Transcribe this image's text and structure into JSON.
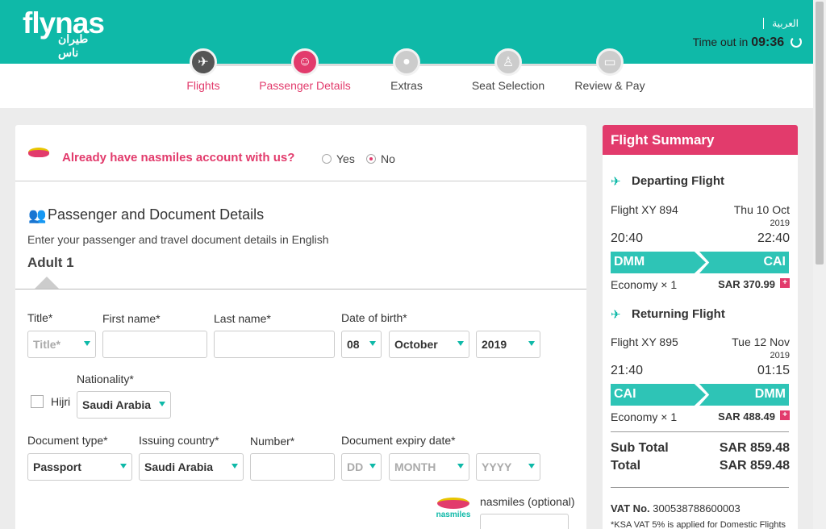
{
  "header": {
    "logo": "flynas",
    "logo_ar": "طيران ناس",
    "language": "العربية",
    "timeout_label": "Time out in",
    "timeout_value": "09:36"
  },
  "steps": [
    {
      "label": "Flights",
      "icon": "plane-icon",
      "state": "done"
    },
    {
      "label": "Passenger Details",
      "icon": "passengers-icon",
      "state": "active"
    },
    {
      "label": "Extras",
      "icon": "dining-icon",
      "state": "pending"
    },
    {
      "label": "Seat Selection",
      "icon": "seat-icon",
      "state": "pending"
    },
    {
      "label": "Review & Pay",
      "icon": "payment-icon",
      "state": "pending"
    }
  ],
  "form": {
    "nasmiles_question": "Already have nasmiles account with us?",
    "yes_label": "Yes",
    "no_label": "No",
    "section_title": "Passenger and Document Details",
    "section_subtitle": "Enter your passenger and travel document details in English",
    "adult_label": "Adult 1",
    "title_label": "Title*",
    "title_placeholder": "Title*",
    "first_name_label": "First name*",
    "last_name_label": "Last name*",
    "dob_label": "Date of birth*",
    "dob_day": "08",
    "dob_month": "October",
    "dob_year": "2019",
    "hijri_label": "Hijri",
    "nationality_label": "Nationality*",
    "nationality_value": "Saudi Arabia",
    "doc_type_label": "Document type*",
    "doc_type_value": "Passport",
    "issuing_label": "Issuing country*",
    "issuing_value": "Saudi Arabia",
    "number_label": "Number*",
    "expiry_label": "Document expiry date*",
    "expiry_dd": "DD",
    "expiry_month": "MONTH",
    "expiry_yyyy": "YYYY",
    "nasmiles_optional_label": "nasmiles (optional)",
    "nasmiles_logo_text": "nasmiles"
  },
  "summary": {
    "title": "Flight Summary",
    "departing": {
      "title": "Departing Flight",
      "flight": "Flight XY 894",
      "date": "Thu 10 Oct",
      "year": "2019",
      "dep_time": "20:40",
      "arr_time": "22:40",
      "from": "DMM",
      "to": "CAI",
      "class": "Economy × 1",
      "price": "SAR 370.99"
    },
    "returning": {
      "title": "Returning Flight",
      "flight": "Flight XY 895",
      "date": "Tue 12 Nov",
      "year": "2019",
      "dep_time": "21:40",
      "arr_time": "01:15",
      "from": "CAI",
      "to": "DMM",
      "class": "Economy × 1",
      "price": "SAR 488.49"
    },
    "subtotal_label": "Sub Total",
    "subtotal_value": "SAR 859.48",
    "total_label": "Total",
    "total_value": "SAR 859.48",
    "vat_label": "VAT No.",
    "vat_value": "300538788600003",
    "vat_note": "*KSA VAT 5% is applied for Domestic Flights"
  },
  "colors": {
    "brand_teal": "#0fb9a8",
    "accent_pink": "#e23b6c"
  }
}
